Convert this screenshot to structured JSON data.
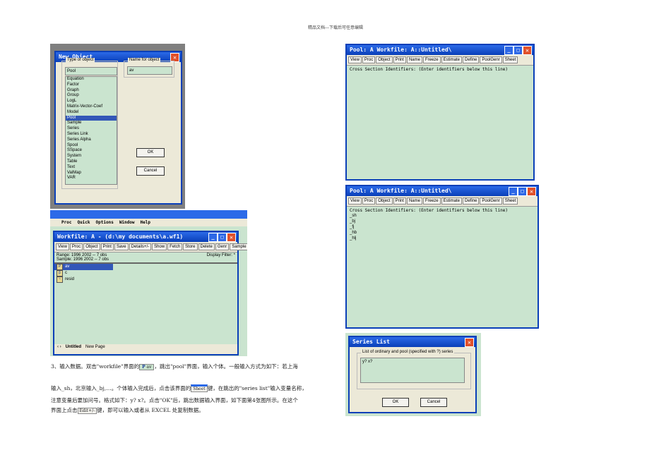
{
  "header": "精品文档---下载后可任意编辑",
  "new_object": {
    "title": "New Object",
    "type_label": "Type of object",
    "type_value": "Pool",
    "name_label": "Name for object",
    "name_value": "av",
    "types": [
      "Equation",
      "Factor",
      "Graph",
      "Group",
      "LogL",
      "Matrix-Vector-Coef",
      "Model",
      "Pool",
      "Sample",
      "Series",
      "Series Link",
      "Series Alpha",
      "Spool",
      "SSpace",
      "System",
      "Table",
      "Text",
      "ValMap",
      "VAR"
    ],
    "selected": "Pool",
    "ok": "OK",
    "cancel": "Cancel"
  },
  "main_menu": [
    "Proc",
    "Quick",
    "Options",
    "Window",
    "Help"
  ],
  "workfile": {
    "title": "Workfile: A - (d:\\my documents\\a.wf1)",
    "toolbar": [
      "View",
      "Proc",
      "Object",
      "Print",
      "Save",
      "Details+/-",
      "Show",
      "Fetch",
      "Store",
      "Delete",
      "Genr",
      "Sample"
    ],
    "range": "Range: 1996 2002  --  7 obs",
    "sample": "Sample: 1996 2002  --  7 obs",
    "filter": "Display Filter: *",
    "objects": [
      {
        "icon": "P",
        "name": "av"
      },
      {
        "icon": "β",
        "name": "c"
      },
      {
        "icon": "~",
        "name": "resid"
      }
    ],
    "tabs": [
      "Untitled",
      "New Page"
    ]
  },
  "pool_toolbar": [
    "View",
    "Proc",
    "Object",
    "Print",
    "Name",
    "Freeze",
    "Estimate",
    "Define",
    "PoolGenr",
    "Sheet"
  ],
  "pool1": {
    "title": "Pool: A    Workfile: A::Untitled\\",
    "text": "Cross Section Identifiers:   (Enter identifiers below this line)"
  },
  "pool2": {
    "title": "Pool: A    Workfile: A::Untitled\\",
    "text": "Cross Section Identifiers:   (Enter identifiers below this line)",
    "ids": [
      "_sh",
      "_bj",
      "_fj",
      "_hb",
      "_hlj"
    ]
  },
  "series_list": {
    "title": "Series List",
    "label": "List of ordinary and pool (specified with ?) series",
    "value": "y? x?",
    "ok": "OK",
    "cancel": "Cancel"
  },
  "paragraphs": {
    "p1a": "3、输入数据。双击\"workfile\"界面的",
    "p1_icon": "av",
    "p1b": "，跳出\"pool\"界面，输入个体。一般输入方式为如下：若上海",
    "p2a": "输入_sh，北京输入_bj,…。个体输入完成后，点击该界面的",
    "p2_btn": "Sheet",
    "p2b": "键，在跳出的\"series list\"输入变量名称，",
    "p3": "注意变量后要加问号。格式如下：y? x?。点击\"OK\"后，跳出数据输入界面，如下面第4张图所示。在这个",
    "p4a": "界面上点击",
    "p4_btn": "Edit+/-",
    "p4b": "键，即可以输入或者从 EXCEL 处复制数据。"
  }
}
